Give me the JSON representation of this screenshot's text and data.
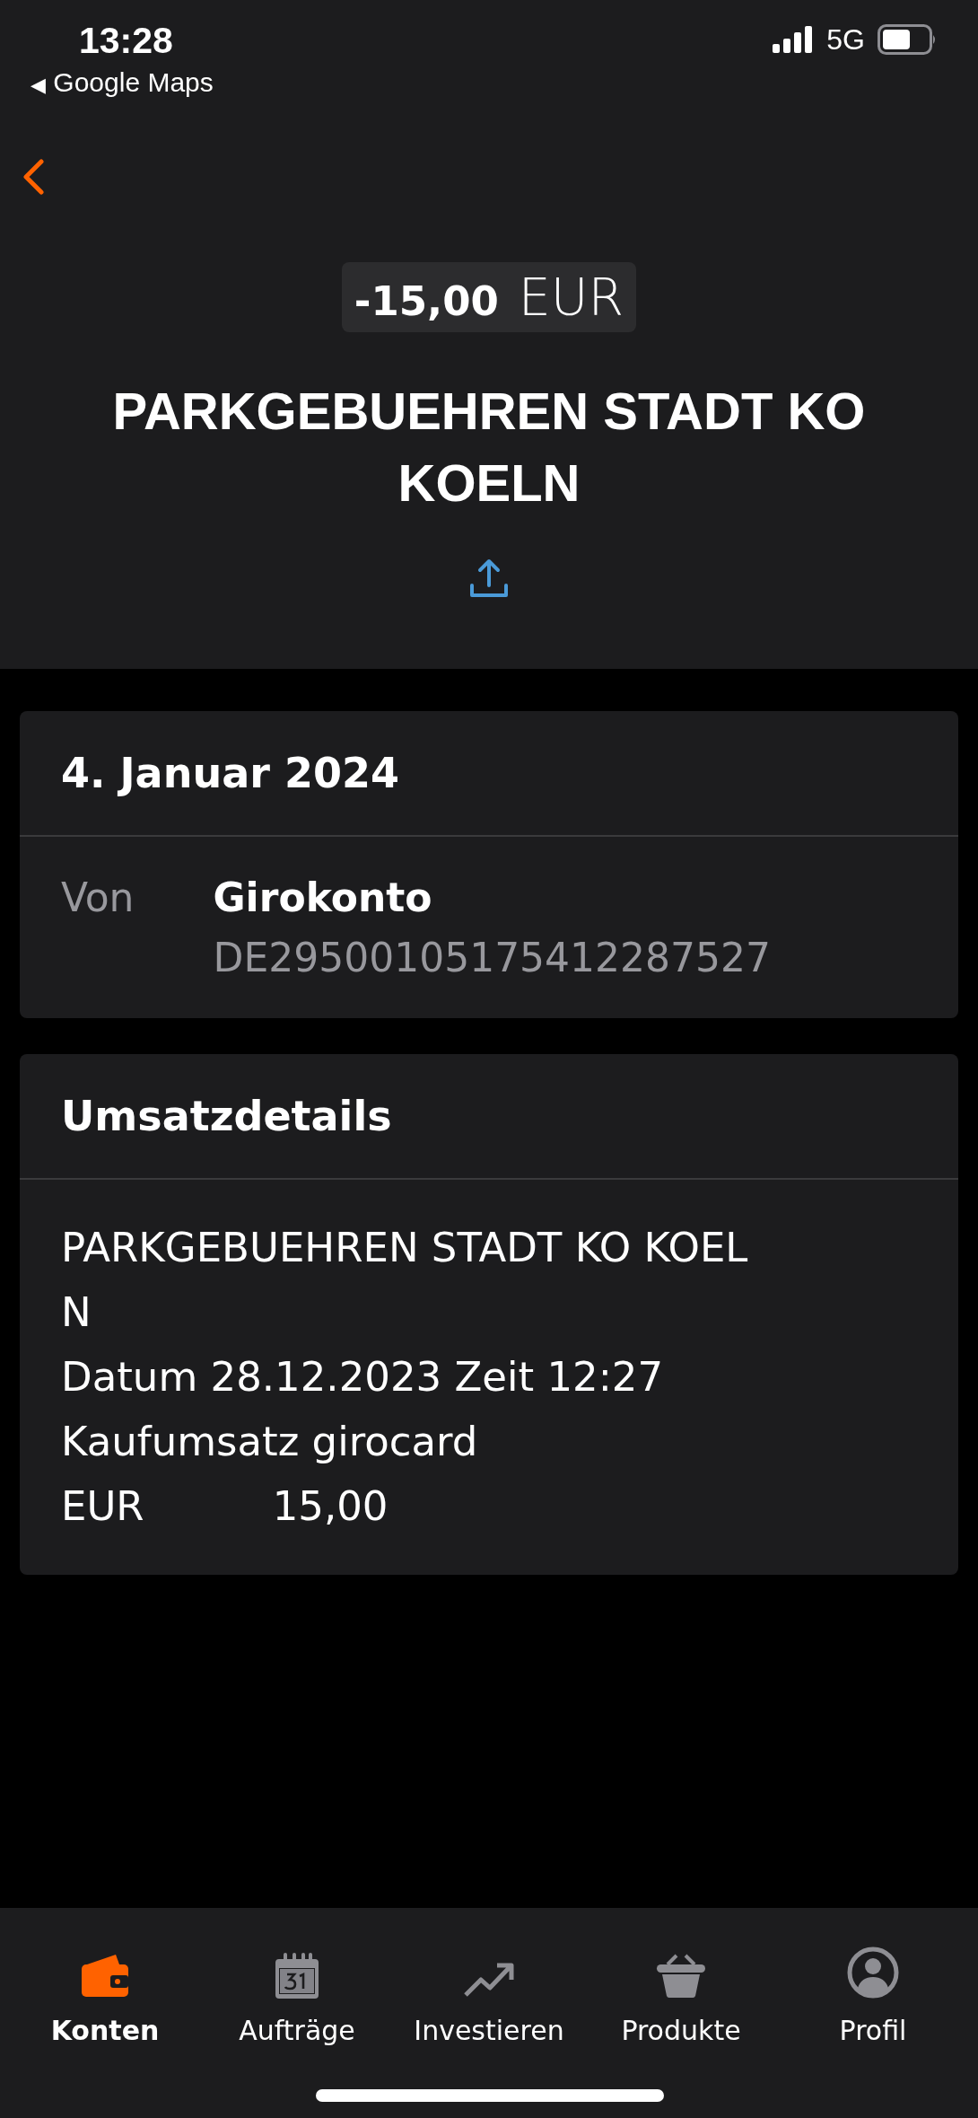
{
  "status_bar": {
    "time": "13:28",
    "back_app": "Google Maps",
    "back_glyph": "◀",
    "network": "5G"
  },
  "transaction": {
    "amount": "-15,00",
    "currency": "EUR",
    "title": "PARKGEBUEHREN STADT KO KOELN"
  },
  "date_card": {
    "title": "4. Januar 2024",
    "label": "Von",
    "account_name": "Girokonto",
    "iban": "DE29500105175412287527"
  },
  "details_card": {
    "title": "Umsatzdetails",
    "lines": [
      "PARKGEBUEHREN STADT KO KOEL",
      "N",
      "Datum 28.12.2023 Zeit 12:27",
      "Kaufumsatz girocard",
      "EUR          15,00"
    ]
  },
  "tab_bar": [
    {
      "label": "Konten",
      "kind": "wallet",
      "selected": true
    },
    {
      "label": "Aufträge",
      "kind": "calendar",
      "selected": false
    },
    {
      "label": "Investieren",
      "kind": "trend",
      "selected": false
    },
    {
      "label": "Produkte",
      "kind": "basket",
      "selected": false
    },
    {
      "label": "Profil",
      "kind": "profile",
      "selected": false
    }
  ]
}
